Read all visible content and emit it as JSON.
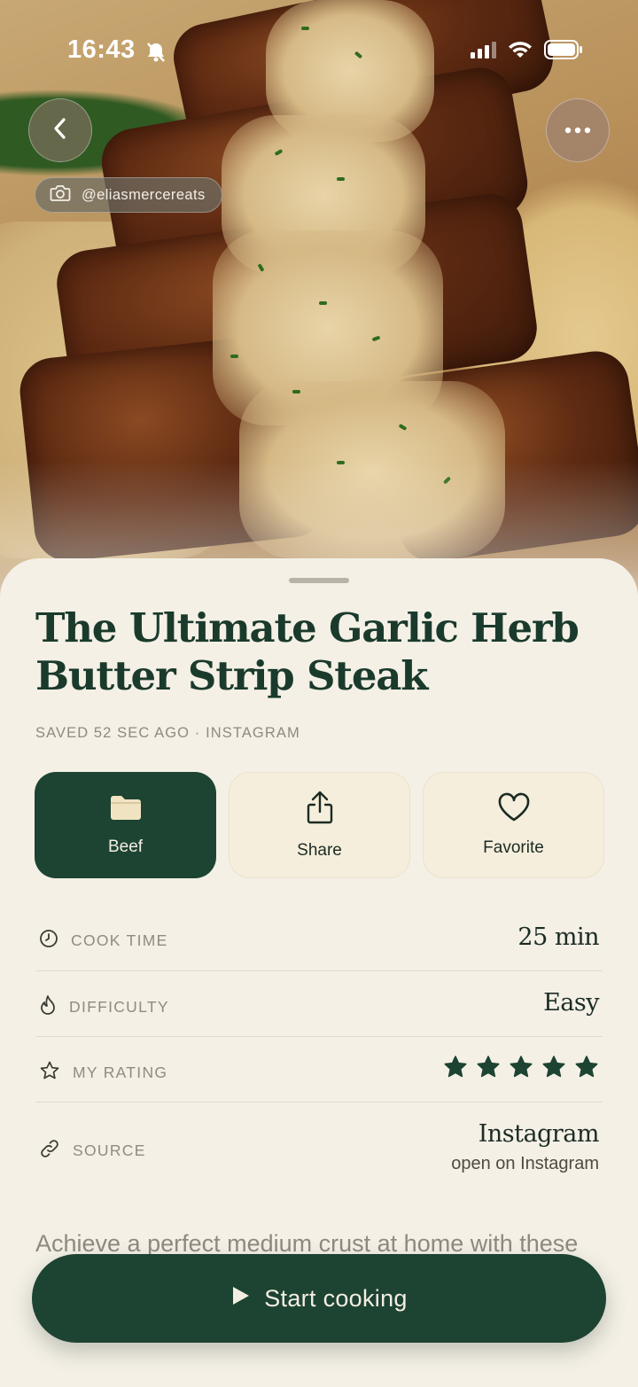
{
  "status_bar": {
    "time": "16:43"
  },
  "hero": {
    "credit_handle": "@eliasmercereats"
  },
  "recipe": {
    "title": "The Ultimate Garlic Herb Butter Strip Steak",
    "meta": "SAVED 52 SEC AGO · INSTAGRAM"
  },
  "actions": {
    "collection_label": "Beef",
    "share_label": "Share",
    "favorite_label": "Favorite"
  },
  "info": {
    "cook_time_label": "COOK TIME",
    "cook_time_value": "25 min",
    "difficulty_label": "DIFFICULTY",
    "difficulty_value": "Easy",
    "rating_label": "MY RATING",
    "rating_stars": 5,
    "rating_max": 5,
    "source_label": "SOURCE",
    "source_value": "Instagram",
    "source_link": "open on Instagram"
  },
  "description": "Achieve a perfect medium crust at home with these",
  "cta": {
    "label": "Start cooking"
  },
  "colors": {
    "primary": "#1d4332",
    "background": "#f4f0e6",
    "card": "#f6eedc"
  }
}
